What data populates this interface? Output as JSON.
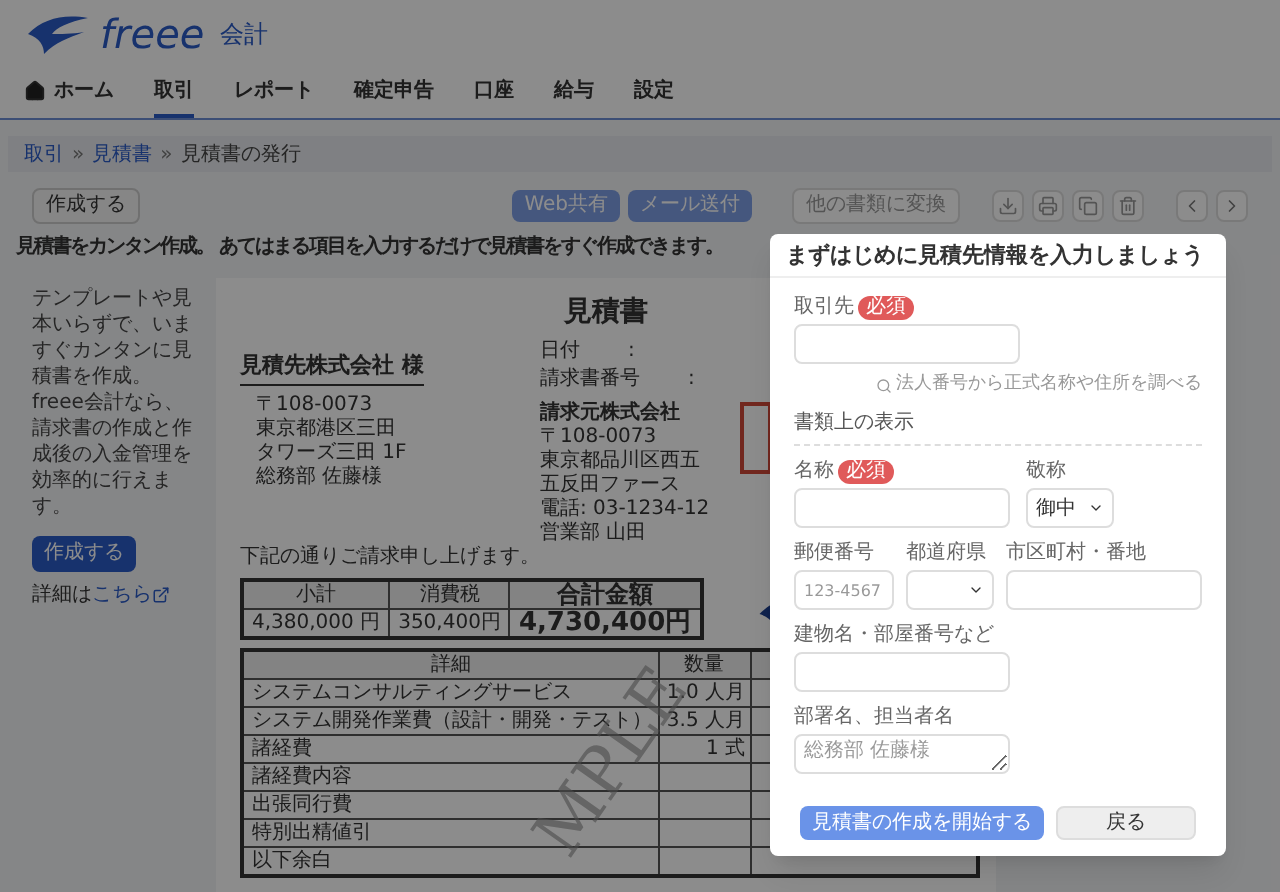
{
  "header": {
    "logo_text": "freee",
    "product": "会計"
  },
  "nav": [
    {
      "label": "ホーム",
      "selected": false,
      "kind": "home"
    },
    {
      "label": "取引",
      "selected": true,
      "kind": "text"
    },
    {
      "label": "レポート",
      "selected": false,
      "kind": "text"
    },
    {
      "label": "確定申告",
      "selected": false,
      "kind": "text"
    },
    {
      "label": "口座",
      "selected": false,
      "kind": "text"
    },
    {
      "label": "給与",
      "selected": false,
      "kind": "text"
    },
    {
      "label": "設定",
      "selected": false,
      "kind": "text"
    }
  ],
  "breadcrumb": {
    "separator": "»",
    "items": [
      {
        "label": "取引",
        "kind": "link"
      },
      {
        "label": "見積書",
        "kind": "link"
      },
      {
        "label": "見積書の発行",
        "kind": "current"
      }
    ]
  },
  "toolbar": {
    "create_button": "作成する",
    "share_buttons": [
      "Web共有",
      "メール送付"
    ],
    "convert_button": "他の書類に変換"
  },
  "intro": "見積書をカンタン作成。 あてはまる項目を入力するだけで見積書をすぐ作成できます。",
  "sidebar": {
    "text": "テンプレートや見本いらずで、いますぐカンタンに見積書を作成。freee会計なら、請求書の作成と作成後の入金管理を効率的に行えます。",
    "button": "作成する",
    "more_prefix": "詳細は",
    "more_link": "こちら"
  },
  "document": {
    "title": "見積書",
    "recipient": "見積先株式会社 様",
    "recipient_address": [
      "〒108-0073",
      "東京都港区三田",
      "タワーズ三田 1F",
      "総務部 佐藤様"
    ],
    "meta": [
      {
        "label": "日付",
        "sep": ":"
      },
      {
        "label": "請求書番号",
        "sep": ":"
      }
    ],
    "issuer_name": "請求元株式会社",
    "issuer_lines": [
      "〒108-0073",
      "東京都品川区西五",
      "五反田ファース",
      "電話: 03-1234-12",
      "営業部 山田"
    ],
    "message": "下記の通りご請求申し上げます。",
    "totals": {
      "subtotal_label": "小計",
      "tax_label": "消費税",
      "total_label": "合計金額",
      "subtotal": "4,380,000 円",
      "tax": "350,400円",
      "total": "4,730,400円"
    },
    "stamp_text": "MPLE",
    "items_columns": [
      "詳細",
      "数量"
    ],
    "items": [
      {
        "detail": "システムコンサルティングサービス",
        "quantity": "1.0 人月"
      },
      {
        "detail": "システム開発作業費（設計・開発・テスト）",
        "quantity": "3.5 人月"
      },
      {
        "detail": "諸経費",
        "quantity": "1 式"
      },
      {
        "detail": "諸経費内容"
      },
      {
        "detail": "出張同行費"
      },
      {
        "detail": "特別出精値引"
      },
      {
        "detail": "以下余白"
      }
    ]
  },
  "modal": {
    "title": "まずはじめに見積先情報を入力しましょう",
    "partner_label": "取引先",
    "partner_required": "必須",
    "lookup_link": "法人番号から正式名称や住所を調べる",
    "section_title": "書類上の表示",
    "name_label": "名称",
    "name_required": "必須",
    "honorific_label": "敬称",
    "honorific_value": "御中",
    "postal_label": "郵便番号",
    "postal_placeholder": "123-4567",
    "prefecture_label": "都道府県",
    "city_label": "市区町村・番地",
    "building_label": "建物名・部屋番号など",
    "department_label": "部署名、担当者名",
    "department_placeholder": "総務部 佐藤様",
    "submit_button": "見積書の作成を開始する",
    "back_button": "戻る"
  }
}
